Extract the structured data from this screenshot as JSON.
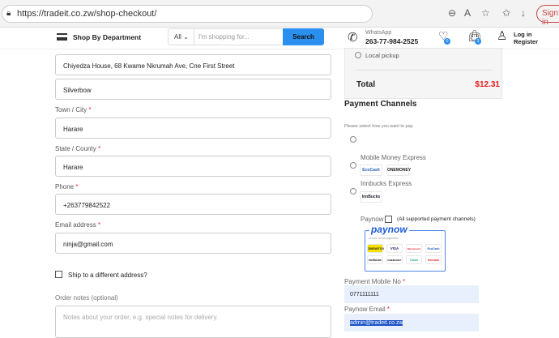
{
  "browser": {
    "url": "https://tradeit.co.zw/shop-checkout/",
    "sign_in": "Sign in"
  },
  "header": {
    "department": "Shop By Department",
    "category": "All",
    "search_placeholder": "I'm shopping for...",
    "search_button": "Search",
    "whatsapp_label": "WhatsApp",
    "whatsapp_number": "263-77-984-2525",
    "wishlist_count": "0",
    "cart_count": "3",
    "login": "Log in",
    "register": "Register"
  },
  "form": {
    "address1": "Chiyedza House, 68 Kwame Nkrumah Ave, Cne First Street",
    "address2": "Silverbow",
    "town_label": "Town / City",
    "town": "Harare",
    "state_label": "State / County",
    "state": "Harare",
    "phone_label": "Phone",
    "phone": "+263779842522",
    "email_label": "Email address",
    "email": "ninja@gmail.com",
    "ship_different": "Ship to a different address?",
    "notes_label": "Order notes (optional)",
    "notes_placeholder": "Notes about your order, e.g. special notes for delivery."
  },
  "order": {
    "local_pickup": "Local pickup",
    "total_label": "Total",
    "total_value": "$12.31",
    "total_color": "#e8161b"
  },
  "payment": {
    "title": "Payment Channels",
    "subtitle": "Please select how you want to pay.",
    "mobile_money": "Mobile Money Express",
    "ecocash": "EcoCash",
    "onemoney": "ONEMONEY",
    "innbucks": "Innbucks Express",
    "innbucks_logo": "InnBucks",
    "paynow": "Paynow",
    "paynow_note": "(All supported payment channels)",
    "paynow_logo": "paynow",
    "paynow_tagline": "secure online payments",
    "paynow_methods": [
      "ZIMSWITCH",
      "VISA",
      "Mastercard",
      "EcoCash",
      "InnBucks",
      "ONEMONEY",
      "Omari",
      "telecash"
    ],
    "mobile_label": "Payment Mobile No",
    "mobile": "0771111111",
    "email_label": "Paynow Email",
    "email": "admin@tradeit.co.zw"
  }
}
